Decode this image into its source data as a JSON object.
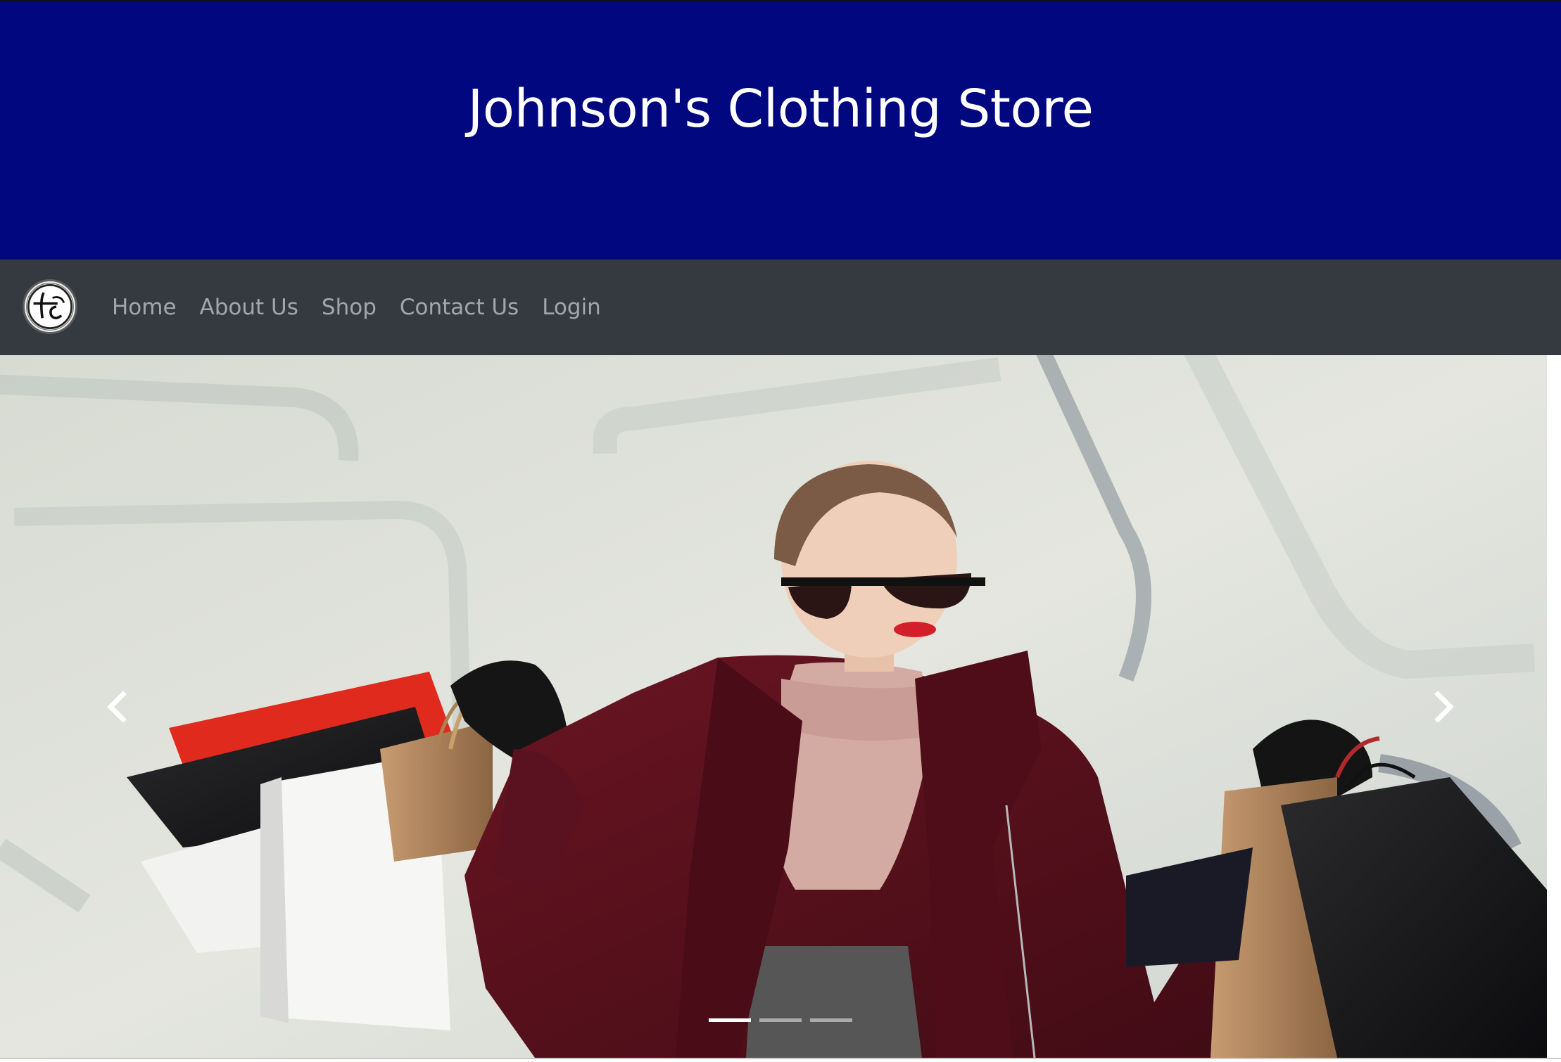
{
  "header": {
    "title": "Johnson's Clothing Store"
  },
  "navbar": {
    "logo_icon": "store-logo-icon",
    "links": [
      {
        "label": "Home"
      },
      {
        "label": "About Us"
      },
      {
        "label": "Shop"
      },
      {
        "label": "Contact Us"
      },
      {
        "label": "Login"
      }
    ]
  },
  "carousel": {
    "slide_count": 3,
    "active_index": 0,
    "prev_icon": "chevron-left-icon",
    "next_icon": "chevron-right-icon"
  },
  "colors": {
    "banner_background": "#01087f",
    "navbar_background": "#343a40",
    "nav_link_color": "#9a9da0",
    "banner_text": "#ffffff"
  }
}
